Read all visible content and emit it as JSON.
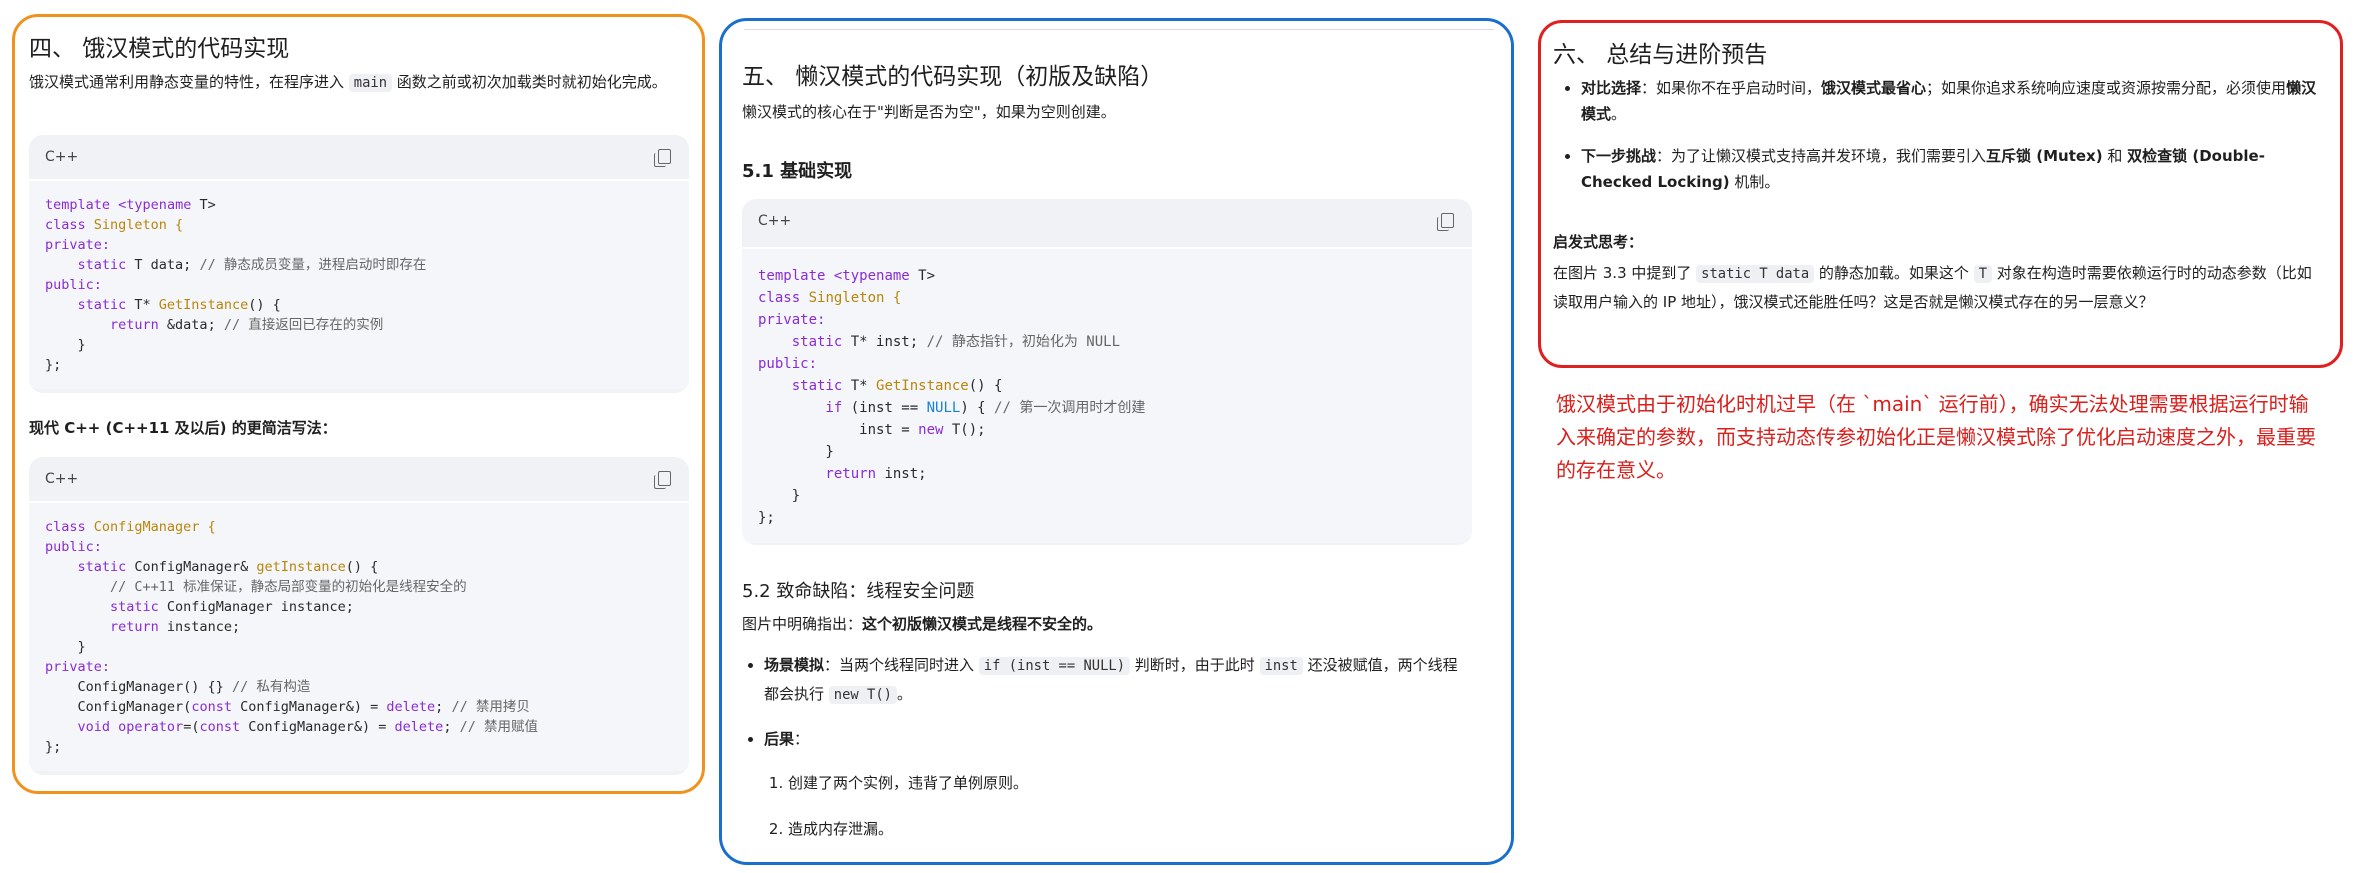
{
  "panel1": {
    "title": "四、 饿汉模式的代码实现",
    "intro_before": "饿汉模式通常利用静态变量的特性，在程序进入 ",
    "intro_code": "main",
    "intro_after": " 函数之前或初次加载类时就初始化完成。",
    "code1_lang": "C++",
    "code1_line_template": "template",
    "code1_line_typename": "<typename",
    "code1_line_t": " T>",
    "code1_class_kw": "class",
    "code1_class_name": "Singleton {",
    "code1_private": "private:",
    "code1_static_data": "    static T data; ",
    "code1_static_data_cm": "// 静态成员变量，进程启动时即存在",
    "code1_public": "public:",
    "code1_getinst_pre": "    static T* ",
    "code1_getinst_fn": "GetInstance",
    "code1_getinst_post": "() {",
    "code1_return_kw": "        return",
    "code1_return_rest": " &data; ",
    "code1_return_cm": "// 直接返回已存在的实例",
    "code1_close_brace": "    }",
    "code1_end": "};",
    "modern_heading": "现代 C++ (C++11 及以后) 的更简洁写法：",
    "code2_lang": "C++",
    "code2_class_kw": "class",
    "code2_class_name": "ConfigManager {",
    "code2_public": "public:",
    "code2_static_pre": "    static ConfigManager& ",
    "code2_static_fn": "getInstance",
    "code2_static_post": "() {",
    "code2_comment": "        // C++11 标准保证，静态局部变量的初始化是线程安全的",
    "code2_static_inst_kw": "        static",
    "code2_static_inst_rest": " ConfigManager instance;",
    "code2_return_kw": "        return",
    "code2_return_rest": " instance;",
    "code2_close_brace": "    }",
    "code2_private": "private:",
    "code2_ctor": "    ConfigManager() {} ",
    "code2_ctor_cm": "// 私有构造",
    "code2_copy_pre": "    ConfigManager(",
    "code2_copy_const": "const",
    "code2_copy_mid": " ConfigManager&) = ",
    "code2_copy_delete": "delete",
    "code2_copy_end": "; ",
    "code2_copy_cm": "// 禁用拷贝",
    "code2_assign_void": "    void",
    "code2_assign_op": " operator",
    "code2_assign_mid": "=(",
    "code2_assign_const": "const",
    "code2_assign_rest": " ConfigManager&) = ",
    "code2_assign_delete": "delete",
    "code2_assign_end": "; ",
    "code2_assign_cm": "// 禁用赋值",
    "code2_end": "};"
  },
  "panel2": {
    "title": "五、 懒汉模式的代码实现（初版及缺陷）",
    "intro": "懒汉模式的核心在于\"判断是否为空\"，如果为空则创建。",
    "section1": "5.1 基础实现",
    "code_lang": "C++",
    "c_template": "template",
    "c_typename": " <typename",
    "c_t": " T>",
    "c_class_kw": "class",
    "c_class_name": " Singleton {",
    "c_private": "private:",
    "c_static_inst_kw": "    static",
    "c_static_inst_rest": " T* inst; ",
    "c_static_inst_cm": "// 静态指针，初始化为 NULL",
    "c_public": "public:",
    "c_static_kw": "    static",
    "c_getinst_pre": " T* ",
    "c_getinst_fn": "GetInstance",
    "c_getinst_post": "() {",
    "c_if_kw": "        if",
    "c_if_mid": " (inst == ",
    "c_if_null": "NULL",
    "c_if_end": ") { ",
    "c_if_cm": "// 第一次调用时才创建",
    "c_new_pre": "            inst = ",
    "c_new_kw": "new",
    "c_new_post": " T();",
    "c_close_if": "        }",
    "c_return_kw": "        return",
    "c_return_rest": " inst;",
    "c_close_fn": "    }",
    "c_end": "};",
    "section2": "5.2 致命缺陷：线程安全问题",
    "defect_label": "图片中明确指出：",
    "defect_text": "这个初版懒汉模式是线程不安全的。",
    "b1_label": "场景模拟",
    "b1_a": "：当两个线程同时进入 ",
    "b1_code1": "if (inst == NULL)",
    "b1_b": " 判断时，由于此时 ",
    "b1_code2": "inst",
    "b1_c": " 还没被赋值，两个线程都会执行 ",
    "b1_code3": "new T()",
    "b1_d": "。",
    "b2_label": "后果",
    "b2_colon": "：",
    "item1": "创建了两个实例，违背了单例原则。",
    "item2": "造成内存泄漏。"
  },
  "panel3": {
    "title": "六、 总结与进阶预告",
    "b1_label": "对比选择",
    "b1_a": "：如果你不在乎启动时间，",
    "b1_bold1": "饿汉模式最省心",
    "b1_b": "；如果你追求系统响应速度或资源按需分配，必须使用",
    "b1_bold2": "懒汉模式",
    "b1_c": "。",
    "b2_label": "下一步挑战",
    "b2_a": "：为了让懒汉模式支持高并发环境，我们需要引入",
    "b2_bold1": "互斥锁 (Mutex)",
    "b2_b": " 和 ",
    "b2_bold2": "双检查锁 (Double-Checked Locking)",
    "b2_c": " 机制。",
    "think_label": "启发式思考：",
    "think_a": "在图片 3.3 中提到了 ",
    "think_code1": "static T data",
    "think_b": " 的静态加载。如果这个 ",
    "think_code2": "T",
    "think_c": " 对象在构造时需要依赖运行时的动态参数（比如读取用户输入的 IP 地址），饿汉模式还能胜任吗？这是否就是懒汉模式存在的另一层意义？"
  },
  "annotation": "饿汉模式由于初始化时机过早（在 `main` 运行前），确实无法处理需要根据运行时输入来确定的参数，而支持动态传参初始化正是懒汉模式除了优化启动速度之外，最重要的存在意义。",
  "colors": {
    "panel1_border": "#f0921e",
    "panel2_border": "#1b6fcc",
    "panel3_border": "#e02020",
    "annotation": "#d9201c"
  }
}
